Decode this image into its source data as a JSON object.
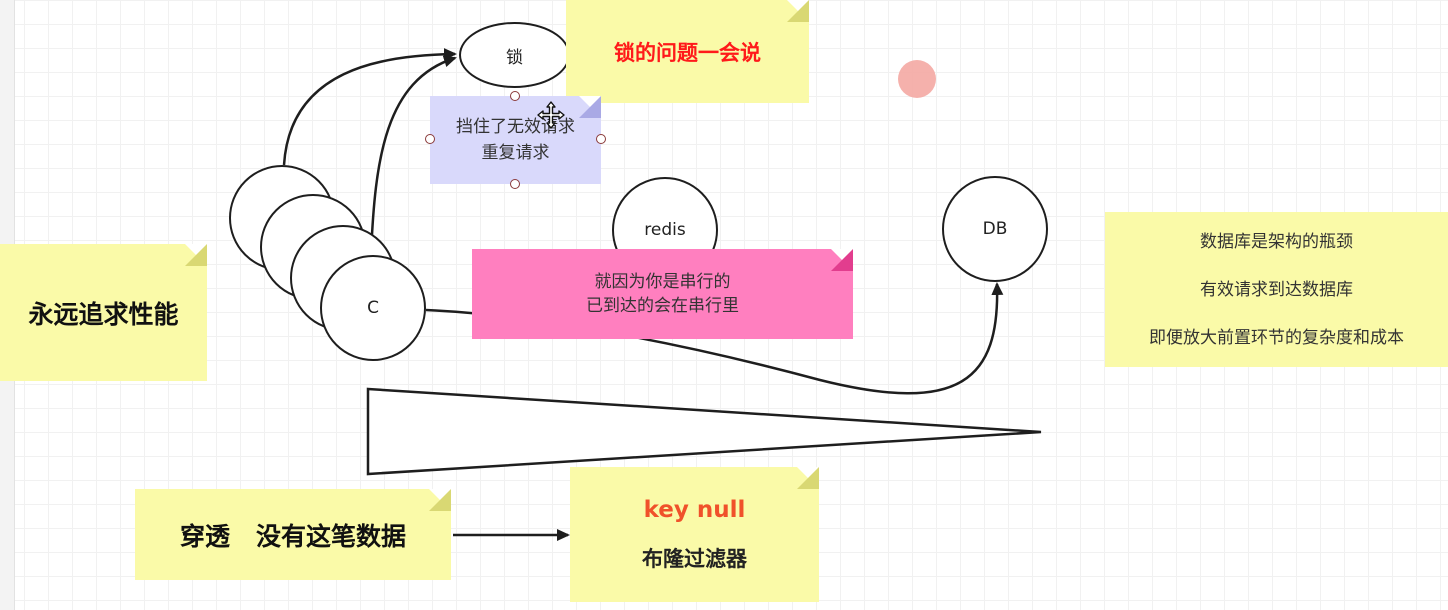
{
  "notes": {
    "lock_later": "锁的问题一会说",
    "always_perf": "永远追求性能",
    "blocked_line1": "挡住了无效请求",
    "blocked_line2": "重复请求",
    "serial_line1": "就因为你是串行的",
    "serial_line2": "已到达的会在串行里",
    "db_line1": "数据库是架构的瓶颈",
    "db_line2": "有效请求到达数据库",
    "db_line3": "即便放大前置环节的复杂度和成本",
    "penetration": "穿透   没有这笔数据",
    "key_null": "key null",
    "bloom_filter": "布隆过滤器"
  },
  "nodes": {
    "lock": "锁",
    "redis": "redis",
    "db": "DB",
    "client": "C"
  },
  "colors": {
    "sticky_yellow": "#fafaa8",
    "sticky_pink": "#ff7fbf",
    "sticky_lavender": "#d9d9fb",
    "red_text": "#ff1a1a",
    "orange_red_text": "#f0512a",
    "stroke": "#1e1e1e"
  },
  "icons": {
    "cursor": "move-cursor-icon",
    "pointer": "red-pointer-dot"
  }
}
